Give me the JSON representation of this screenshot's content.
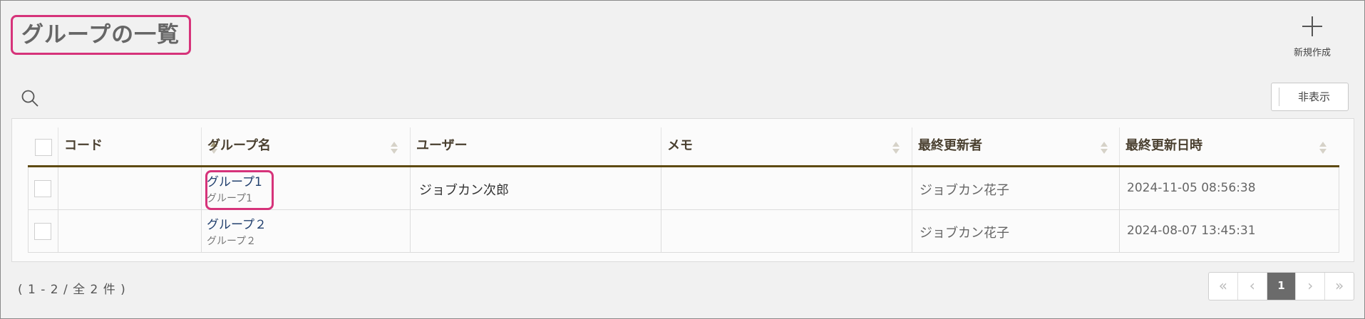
{
  "page": {
    "title": "グループの一覧"
  },
  "toolbar": {
    "new_label": "新規作成",
    "hide_label": "非表示"
  },
  "table": {
    "columns": [
      {
        "label": "コード",
        "sort": "asc"
      },
      {
        "label": "グループ名",
        "sort": "none"
      },
      {
        "label": "ユーザー",
        "sort": "disabled"
      },
      {
        "label": "メモ",
        "sort": "none"
      },
      {
        "label": "最終更新者",
        "sort": "none"
      },
      {
        "label": "最終更新日時",
        "sort": "none"
      }
    ],
    "rows": [
      {
        "code": "",
        "group_name": "グループ1",
        "group_sub": "グループ1",
        "user": "ジョブカン次郎",
        "memo": "",
        "updated_by": "ジョブカン花子",
        "updated_at": "2024-11-05 08:56:38"
      },
      {
        "code": "",
        "group_name": "グループ２",
        "group_sub": "グループ２",
        "user": "",
        "memo": "",
        "updated_by": "ジョブカン花子",
        "updated_at": "2024-08-07 13:45:31"
      }
    ]
  },
  "footer": {
    "count_text": "( 1 - 2 / 全 2 件 )"
  },
  "pagination": {
    "first": "«",
    "prev": "‹",
    "current": "1",
    "next": "›",
    "last": "»"
  },
  "icons": {
    "search": "search-icon",
    "add": "plus-icon"
  },
  "colors": {
    "highlight": "#d6337a",
    "header_rule": "#5e4a12",
    "link": "#22406e"
  }
}
